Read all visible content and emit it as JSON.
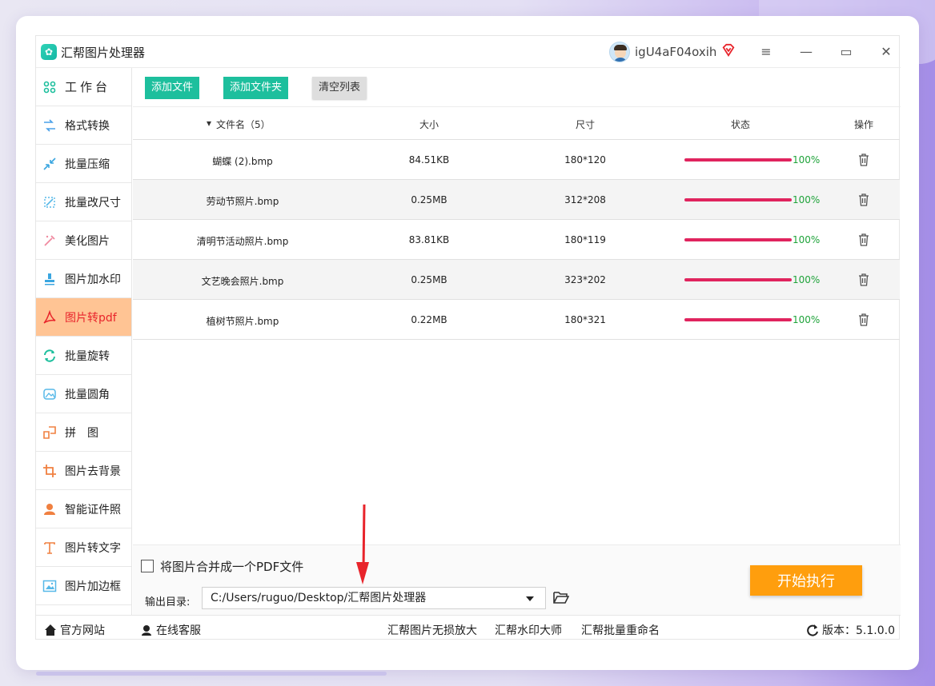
{
  "app": {
    "title": "汇帮图片处理器",
    "username": "igU4aF04oxih"
  },
  "window_controls": {
    "menu": "≡",
    "minimize": "—",
    "maximize": "▭",
    "close": "✕"
  },
  "sidebar": {
    "items": [
      {
        "label": "工作台",
        "icon": "grid-icon",
        "color": "#1dbf9d"
      },
      {
        "label": "格式转换",
        "icon": "convert-icon",
        "color": "#4aa0e8"
      },
      {
        "label": "批量压缩",
        "icon": "compress-icon",
        "color": "#3aa6e0"
      },
      {
        "label": "批量改尺寸",
        "icon": "resize-icon",
        "color": "#56b8e8"
      },
      {
        "label": "美化图片",
        "icon": "beautify-icon",
        "color": "#f08aa0"
      },
      {
        "label": "图片加水印",
        "icon": "watermark-icon",
        "color": "#3aa6e0"
      },
      {
        "label": "图片转pdf",
        "icon": "pdf-icon",
        "color": "#e8242b",
        "active": true
      },
      {
        "label": "批量旋转",
        "icon": "rotate-icon",
        "color": "#1dbf9d"
      },
      {
        "label": "批量圆角",
        "icon": "round-corner-icon",
        "color": "#56b8e8"
      },
      {
        "label": "拼　图",
        "icon": "puzzle-icon",
        "color": "#f08040"
      },
      {
        "label": "图片去背景",
        "icon": "crop-icon",
        "color": "#f08040"
      },
      {
        "label": "智能证件照",
        "icon": "id-photo-icon",
        "color": "#f08040"
      },
      {
        "label": "图片转文字",
        "icon": "text-icon",
        "color": "#f08040"
      },
      {
        "label": "图片加边框",
        "icon": "frame-icon",
        "color": "#56b8e8"
      }
    ]
  },
  "toolbar": {
    "add_file": "添加文件",
    "add_folder": "添加文件夹",
    "clear_list": "清空列表"
  },
  "table": {
    "headers": {
      "name": "文件名（5）",
      "size": "大小",
      "dimensions": "尺寸",
      "status": "状态",
      "action": "操作"
    },
    "rows": [
      {
        "name": "蝴蝶 (2).bmp",
        "size": "84.51KB",
        "dimensions": "180*120",
        "progress": "100%"
      },
      {
        "name": "劳动节照片.bmp",
        "size": "0.25MB",
        "dimensions": "312*208",
        "progress": "100%"
      },
      {
        "name": "清明节活动照片.bmp",
        "size": "83.81KB",
        "dimensions": "180*119",
        "progress": "100%"
      },
      {
        "name": "文艺晚会照片.bmp",
        "size": "0.25MB",
        "dimensions": "323*202",
        "progress": "100%"
      },
      {
        "name": "植树节照片.bmp",
        "size": "0.22MB",
        "dimensions": "180*321",
        "progress": "100%"
      }
    ]
  },
  "options": {
    "merge_label": "将图片合并成一个PDF文件",
    "output_label": "输出目录:",
    "output_path": "C:/Users/ruguo/Desktop/汇帮图片处理器",
    "start_button": "开始执行"
  },
  "footer": {
    "website": "官方网站",
    "support": "在线客服",
    "link1": "汇帮图片无损放大",
    "link2": "汇帮水印大师",
    "link3": "汇帮批量重命名",
    "version": "版本：5.1.0.0"
  },
  "colors": {
    "accent_green": "#1dbf9d",
    "active_bg": "#ffc494",
    "progress": "#e0245e",
    "start_orange": "#ff9e0d",
    "arrow_red": "#e8242b"
  }
}
